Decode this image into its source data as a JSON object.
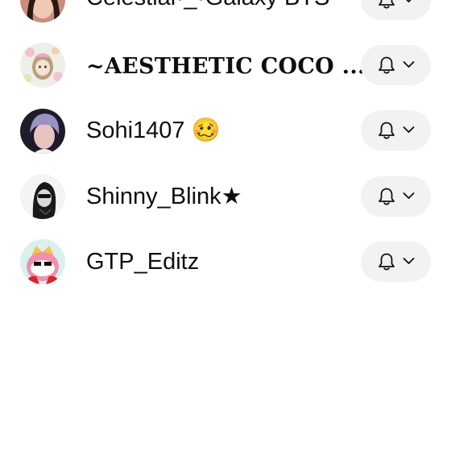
{
  "channels": [
    {
      "name": "Celestial•_•Galaxy BTS",
      "avatar_icon": "avatar-celestial-galaxy-bts-icon"
    },
    {
      "name": "~AESTHETIC COCO ...",
      "avatar_icon": "avatar-aesthetic-coco-icon"
    },
    {
      "name": "Sohi1407 🥴",
      "avatar_icon": "avatar-sohi1407-icon"
    },
    {
      "name": "Shinny_Blink★",
      "avatar_icon": "avatar-shinny-blink-icon"
    },
    {
      "name": "GTP_Editz",
      "avatar_icon": "avatar-gtp-editz-icon"
    }
  ],
  "notification_button": {
    "icons": [
      "bell-icon",
      "chevron-down-icon"
    ]
  },
  "colors": {
    "pill_background": "#f2f2f2",
    "text": "#0f0f0f",
    "page_background": "#ffffff"
  }
}
